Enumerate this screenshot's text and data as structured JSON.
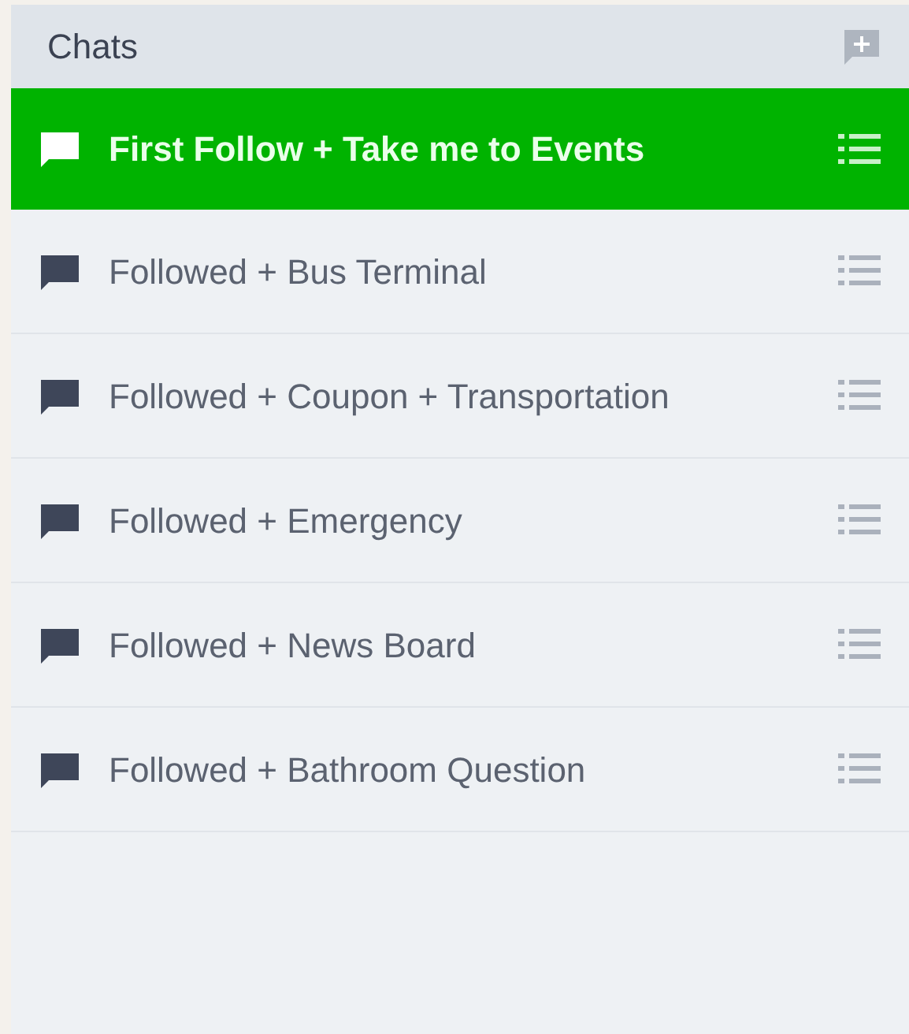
{
  "header": {
    "title": "Chats"
  },
  "chats": [
    {
      "title": "First Follow + Take me to Events",
      "selected": true
    },
    {
      "title": "Followed + Bus Terminal",
      "selected": false
    },
    {
      "title": "Followed + Coupon + Transportation",
      "selected": false
    },
    {
      "title": "Followed + Emergency",
      "selected": false
    },
    {
      "title": "Followed + News Board",
      "selected": false
    },
    {
      "title": "Followed + Bathroom Question",
      "selected": false
    }
  ]
}
